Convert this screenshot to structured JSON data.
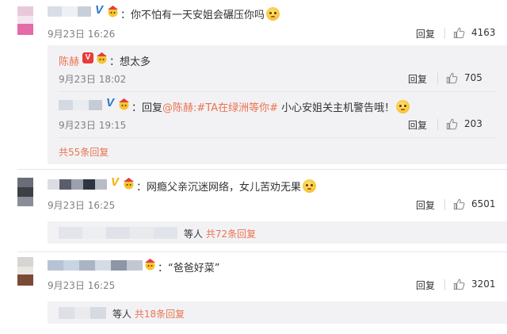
{
  "comments": [
    {
      "text": "：你不怕有一天安姐会碾压你吗",
      "time": "9月23日 16:26",
      "reply_label": "回复",
      "likes": "4163",
      "replies": [
        {
          "nick": "陈赫",
          "text": "：想太多",
          "time": "9月23日 18:02",
          "reply_label": "回复",
          "likes": "705"
        },
        {
          "prefix": "：回复",
          "mention": "@陈赫",
          "topic": ":#TA在绿洲等你#",
          "text": " 小心安姐关主机警告哦！",
          "time": "9月23日 19:15",
          "reply_label": "回复",
          "likes": "203"
        }
      ],
      "more": "共55条回复"
    },
    {
      "text": "：网瘾父亲沉迷网络，女儿苦劝无果",
      "time": "9月23日 16:25",
      "reply_label": "回复",
      "likes": "6501",
      "more_prefix": "等人",
      "more": "共72条回复"
    },
    {
      "text": "：“爸爸好菜”",
      "time": "9月23日 16:25",
      "reply_label": "回复",
      "likes": "3201",
      "more_prefix": "等人",
      "more": "共18条回复"
    }
  ],
  "colors": {
    "link": "#eb7350",
    "meta": "#808080",
    "reply_bg": "#f2f2f5",
    "vip_badge": "#f5b000",
    "verified_blue": "#2b78c8"
  },
  "icons": [
    "like-thumb-icon",
    "emoji-icon",
    "vip-badge-icon",
    "hat-badge-icon"
  ]
}
